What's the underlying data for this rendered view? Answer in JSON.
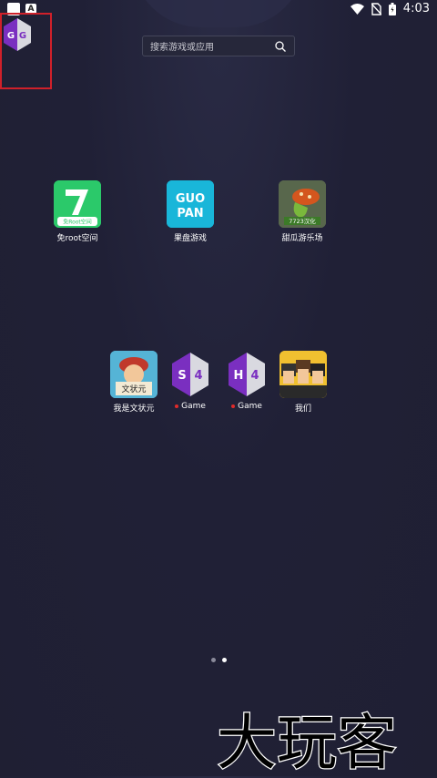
{
  "status_bar": {
    "badge": "A",
    "time": "4:03"
  },
  "search": {
    "placeholder": "搜索游戏或应用"
  },
  "apps_row1": [
    {
      "label": "免root空间",
      "icon_text": "7",
      "sub": "免Root空间"
    },
    {
      "label": "果盘游戏",
      "icon_text": "GUO PAN"
    },
    {
      "label": "甜瓜游乐场",
      "icon_text": "7723汉化"
    }
  ],
  "apps_row2": [
    {
      "label": "我是文状元",
      "icon_text": "文状元"
    },
    {
      "label": "Game",
      "icon_text": "S4"
    },
    {
      "label": "Game",
      "icon_text": "H4"
    },
    {
      "label": "我们",
      "icon_text": ""
    }
  ],
  "watermark": {
    "text": "大玩客"
  },
  "colors": {
    "accent_red": "#e12a2a",
    "gg_purple": "#7a2fc0",
    "green_app": "#2bc96a",
    "cyan_app": "#19b6d9"
  }
}
